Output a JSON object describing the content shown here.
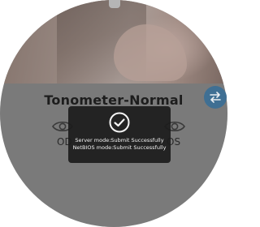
{
  "screen": {
    "title": "Tonometer-Normal",
    "eyes": {
      "left_label": "OD",
      "right_label": "OS"
    }
  },
  "icons": {
    "left_eye": "eye-icon",
    "right_eye": "eye-icon",
    "switch": "switch-arrows-icon",
    "toast": "check-circle-icon"
  },
  "toast": {
    "line1": "Server mode:Submit Successfully",
    "line2": "NetBIOS mode:Submit Successfully"
  },
  "colors": {
    "switch_button": "#3f6f93",
    "toast_background": "#1c1c1c"
  }
}
